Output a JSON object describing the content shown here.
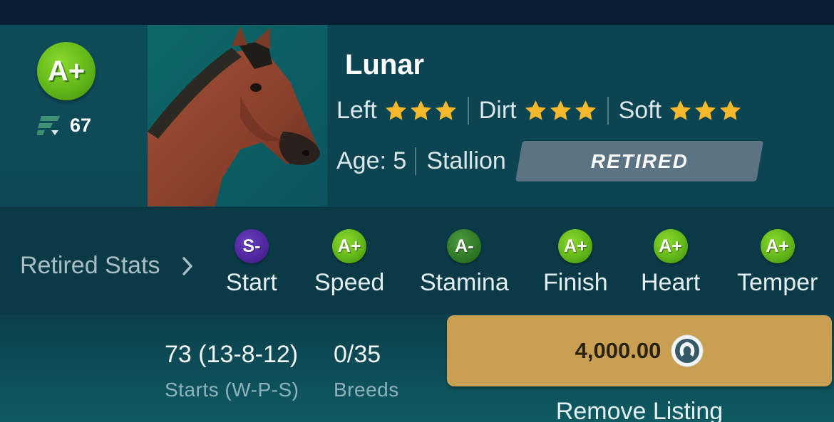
{
  "horse": {
    "name": "Lunar",
    "overall_grade": "A+",
    "rating": "67",
    "rating_icon": "f-logo-icon",
    "age_label": "Age: 5",
    "gender": "Stallion",
    "status": "RETIRED"
  },
  "surfaces": [
    {
      "label": "Left",
      "stars": 3
    },
    {
      "label": "Dirt",
      "stars": 3
    },
    {
      "label": "Soft",
      "stars": 3
    }
  ],
  "stats": {
    "title": "Retired Stats",
    "items": [
      {
        "grade": "S-",
        "label": "Start"
      },
      {
        "grade": "A+",
        "label": "Speed"
      },
      {
        "grade": "A-",
        "label": "Stamina"
      },
      {
        "grade": "A+",
        "label": "Finish"
      },
      {
        "grade": "A+",
        "label": "Heart"
      },
      {
        "grade": "A+",
        "label": "Temper"
      }
    ]
  },
  "record": {
    "starts_value": "73 (13-8-12)",
    "starts_label": "Starts (W-P-S)",
    "breeds_value": "0/35",
    "breeds_label": "Breeds"
  },
  "listing": {
    "price": "4,000.00",
    "currency_icon": "horseshoe-coin-icon",
    "remove_label": "Remove Listing"
  },
  "colors": {
    "background": "#0c4a55",
    "grade_a_plus": "#5fb318",
    "grade_a_minus": "#2d7424",
    "grade_s_minus": "#4c249a",
    "star": "#f5b82a",
    "price_button": "#c9a052",
    "retired_tag": "#5c7383"
  }
}
